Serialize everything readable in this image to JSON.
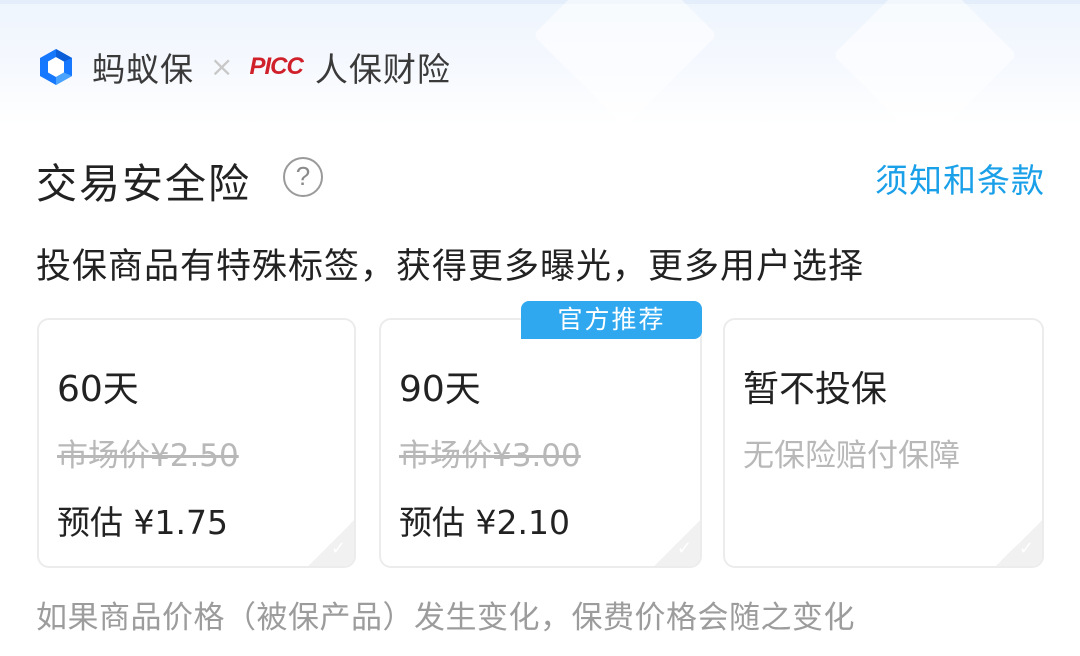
{
  "header": {
    "brand": "蚂蚁保",
    "separator": "×",
    "partner_logo": "PICC",
    "partner_name": "人保财险"
  },
  "insurance": {
    "title": "交易安全险",
    "help_icon": "?",
    "terms_link": "须知和条款",
    "description": "投保商品有特殊标签，获得更多曝光，更多用户选择"
  },
  "options": [
    {
      "duration": "60天",
      "market_price": "市场价¥2.50",
      "estimate": "预估 ¥1.75"
    },
    {
      "duration": "90天",
      "market_price": "市场价¥3.00",
      "estimate": "预估 ¥2.10",
      "badge": "官方推荐"
    },
    {
      "duration": "暂不投保",
      "note": "无保险赔付保障"
    }
  ],
  "check_mark": "✓",
  "footnote": "如果商品价格（被保产品）发生变化，保费价格会随之变化",
  "colors": {
    "accent": "#1aa0e8",
    "badge": "#2fa8f0",
    "picc_red": "#d0202a",
    "ant_blue": "#1677ff"
  },
  "icons": {
    "brand_logo": "ant-insurance-logo-icon",
    "separator": "times-icon",
    "help": "question-circle-icon",
    "check": "check-corner-icon"
  }
}
